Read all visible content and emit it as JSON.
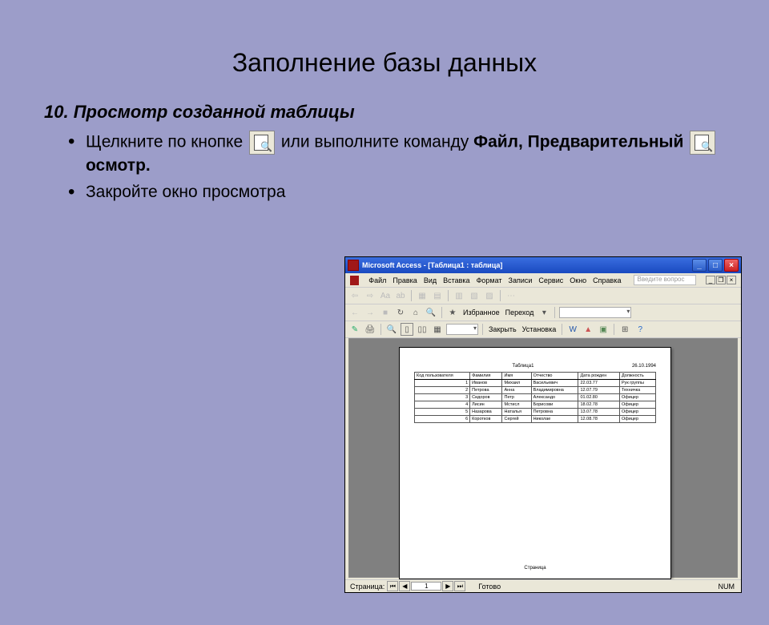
{
  "slide": {
    "title": "Заполнение базы данных",
    "subtitle": "10. Просмотр созданной таблицы",
    "bullet1_pre": "Щелкните по кнопке",
    "bullet1_mid": "или выполните команду ",
    "bullet1_b1": "Файл, Предварительный",
    "bullet1_post": "осмотр.",
    "bullet2": "Закройте окно просмотра"
  },
  "access": {
    "appicon_letter": "",
    "titlebar": "Microsoft Access - [Таблица1 : таблица]",
    "menu": {
      "file": "Файл",
      "edit": "Правка",
      "view": "Вид",
      "insert": "Вставка",
      "format": "Формат",
      "records": "Записи",
      "tools": "Сервис",
      "window": "Окно",
      "help": "Справка"
    },
    "search_placeholder": "Введите вопрос",
    "toolbar3": {
      "favorites": "Избранное",
      "goto": "Переход"
    },
    "toolbar4": {
      "close": "Закрыть",
      "setup": "Установка"
    },
    "page": {
      "title": "Таблица1",
      "date": "26.10.1994",
      "headers": [
        "Код пользователя",
        "Фамилия",
        "Имя",
        "Отчество",
        "Дата рожден",
        "Должность"
      ],
      "rows": [
        {
          "c1": "1",
          "c2": "Иванов",
          "c3": "Михаил",
          "c4": "Васильевич",
          "c5": "22.03.77",
          "c6": "Рук группы"
        },
        {
          "c1": "2",
          "c2": "Петрова",
          "c3": "Анна",
          "c4": "Владимировна",
          "c5": "12.07.79",
          "c6": "Техничка"
        },
        {
          "c1": "3",
          "c2": "Сидоров",
          "c3": "Петр",
          "c4": "Александо",
          "c5": "01.02.80",
          "c6": "Офицер"
        },
        {
          "c1": "4",
          "c2": "Лисин",
          "c3": "Мстисл",
          "c4": "Борисови",
          "c5": "18.02.78",
          "c6": "Офицер"
        },
        {
          "c1": "5",
          "c2": "Назарова",
          "c3": "Наталья",
          "c4": "Петровна",
          "c5": "13.07.78",
          "c6": "Офицер"
        },
        {
          "c1": "6",
          "c2": "Коротков",
          "c3": "Сергей",
          "c4": "Николае",
          "c5": "12.08.78",
          "c6": "Офицер"
        }
      ],
      "footer": "Страница"
    },
    "status": {
      "pager_label": "Страница:",
      "page_num": "1",
      "ready": "Готово",
      "num": "NUM"
    }
  }
}
